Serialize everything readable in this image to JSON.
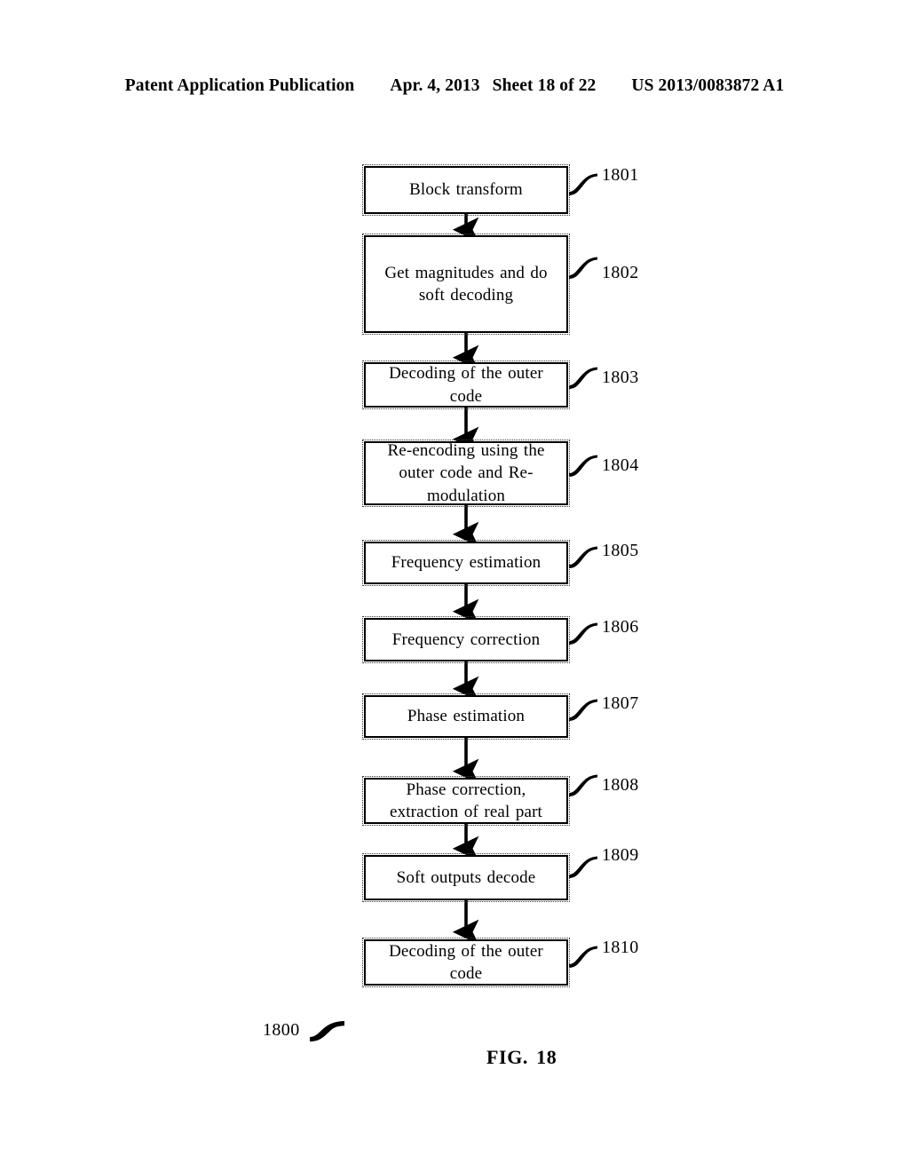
{
  "header": {
    "publication": "Patent Application Publication",
    "date": "Apr. 4, 2013",
    "sheet": "Sheet 18 of 22",
    "patent_number": "US 2013/0083872 A1"
  },
  "figure": {
    "caption": "FIG. 18",
    "figure_id": "1800",
    "nodes": [
      {
        "ref": "1801",
        "label": "Block transform"
      },
      {
        "ref": "1802",
        "label": "Get magnitudes and  do\nsoft decoding"
      },
      {
        "ref": "1803",
        "label": "Decoding of the  outer\ncode"
      },
      {
        "ref": "1804",
        "label": "Re-encoding  using  the\nouter code and  Re-\nmodulation"
      },
      {
        "ref": "1805",
        "label": "Frequency estimation"
      },
      {
        "ref": "1806",
        "label": "Frequency correction"
      },
      {
        "ref": "1807",
        "label": "Phase  estimation"
      },
      {
        "ref": "1808",
        "label": "Phase correction,\nextraction of real part"
      },
      {
        "ref": "1809",
        "label": "Soft outputs decode"
      },
      {
        "ref": "1810",
        "label": "Decoding of the  outer\ncode"
      }
    ]
  },
  "colors": {
    "ink": "#000000",
    "paper": "#ffffff"
  }
}
